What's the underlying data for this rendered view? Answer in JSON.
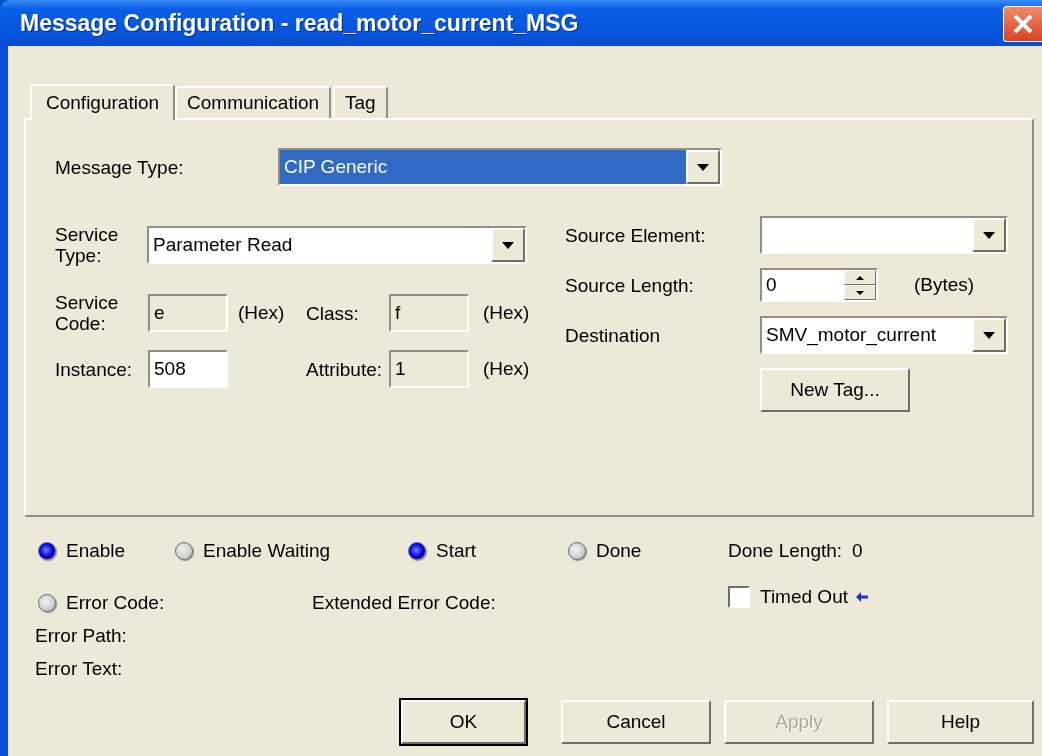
{
  "window": {
    "title": "Message Configuration - read_motor_current_MSG"
  },
  "tabs": [
    {
      "label": "Configuration",
      "selected": true
    },
    {
      "label": "Communication",
      "selected": false
    },
    {
      "label": "Tag",
      "selected": false
    }
  ],
  "message_type": {
    "label": "Message Type:",
    "value": "CIP Generic"
  },
  "service_type": {
    "label": "Service Type:",
    "value": "Parameter Read"
  },
  "service_code": {
    "label": "Service Code:",
    "value": "e",
    "unit": "(Hex)",
    "disabled": true
  },
  "class": {
    "label": "Class:",
    "value": "f",
    "unit": "(Hex)",
    "disabled": true
  },
  "instance": {
    "label": "Instance:",
    "value": "508",
    "disabled": false
  },
  "attribute": {
    "label": "Attribute:",
    "value": "1",
    "unit": "(Hex)",
    "disabled": true
  },
  "source_element": {
    "label": "Source Element:"
  },
  "source_length": {
    "label": "Source Length:",
    "value": "0",
    "unit": "(Bytes)"
  },
  "destination": {
    "label": "Destination",
    "value": "SMV_motor_current"
  },
  "new_tag_button": {
    "label": "New Tag..."
  },
  "indicators": [
    {
      "label": "Enable",
      "on": true
    },
    {
      "label": "Enable Waiting",
      "on": false
    },
    {
      "label": "Start",
      "on": true
    },
    {
      "label": "Done",
      "on": false
    }
  ],
  "done_length": {
    "label": "Done Length:",
    "value": "0"
  },
  "error_code": {
    "label": "Error Code:",
    "on": false
  },
  "extended_error_code": {
    "label": "Extended Error Code:"
  },
  "timed_out": {
    "label": "Timed Out",
    "checked": false
  },
  "error_path": {
    "label": "Error Path:"
  },
  "error_text": {
    "label": "Error Text:"
  },
  "buttons": [
    {
      "label": "OK",
      "default": true,
      "disabled": false
    },
    {
      "label": "Cancel",
      "default": false,
      "disabled": false
    },
    {
      "label": "Apply",
      "default": false,
      "disabled": true
    },
    {
      "label": "Help",
      "default": false,
      "disabled": false
    }
  ]
}
